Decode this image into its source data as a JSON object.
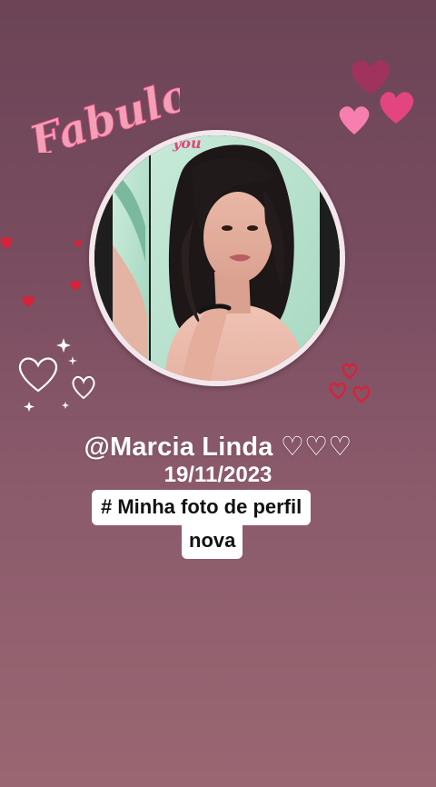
{
  "sticker": {
    "text": "Fabulous"
  },
  "profile": {
    "username": "@Marcia Linda ♡♡♡",
    "date": "19/11/2023",
    "photo_overlay_text": "you"
  },
  "caption": {
    "line1": "# Minha foto de perfil",
    "line2": "nova"
  },
  "colors": {
    "background_top": "#6b4456",
    "background_bottom": "#9a6672",
    "sticker_pink": "#f2a0b6",
    "heart_magenta": "#e2457f",
    "heart_pink": "#f77fb0",
    "heart_dark": "#a0335e",
    "heart_red": "#d6233a",
    "caption_box": "#ffffff"
  },
  "icons": [
    "heart-icon",
    "heart-outline-icon",
    "sparkle-icon"
  ]
}
